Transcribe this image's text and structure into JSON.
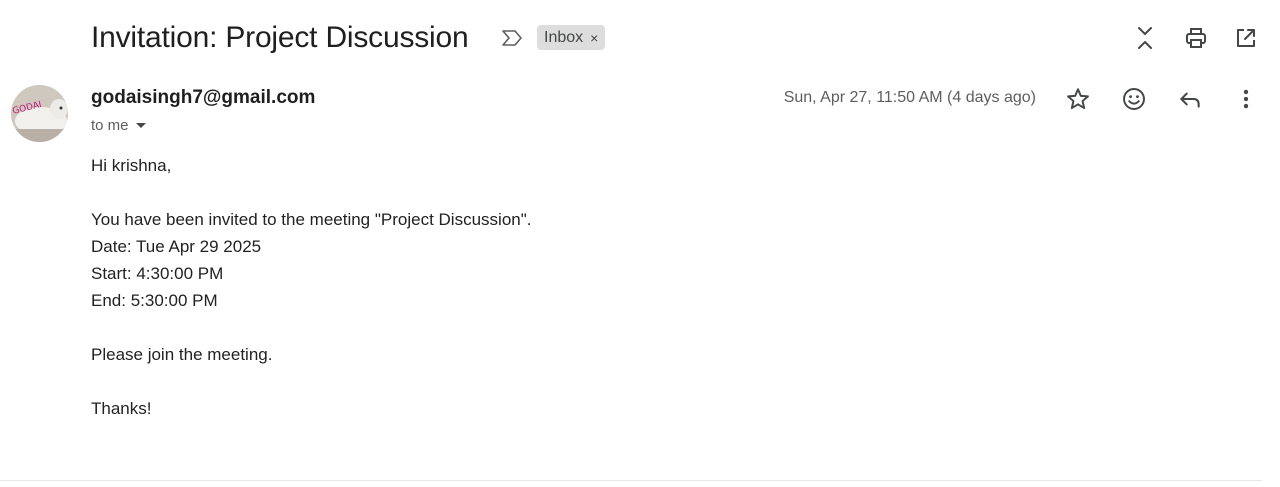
{
  "subject": {
    "title": "Invitation: Project Discussion",
    "label": "Inbox",
    "label_remove": "×"
  },
  "toolbar": {
    "icons": [
      "expand-collapse-icon",
      "print-icon",
      "open-in-new-window-icon"
    ]
  },
  "message": {
    "sender": "godaisingh7@gmail.com",
    "recipient_label": "to me",
    "avatar_text": "GODAI",
    "date": "Sun, Apr 27, 11:50 AM (4 days ago)",
    "action_icons": [
      "star-icon",
      "emoji-reaction-icon",
      "reply-icon",
      "more-vert-icon"
    ],
    "body": {
      "greeting": "Hi krishna,",
      "line1": "You have been invited to the meeting \"Project Discussion\".",
      "line2": "Date: Tue Apr 29 2025",
      "line3": "Start: 4:30:00 PM",
      "line4": "End: 5:30:00 PM",
      "line5": "Please join the meeting.",
      "closing": "Thanks!"
    }
  },
  "colors": {
    "text": "#1f1f1f",
    "muted": "#5e5e5e",
    "chip": "#dddddd",
    "icon": "#444746"
  }
}
